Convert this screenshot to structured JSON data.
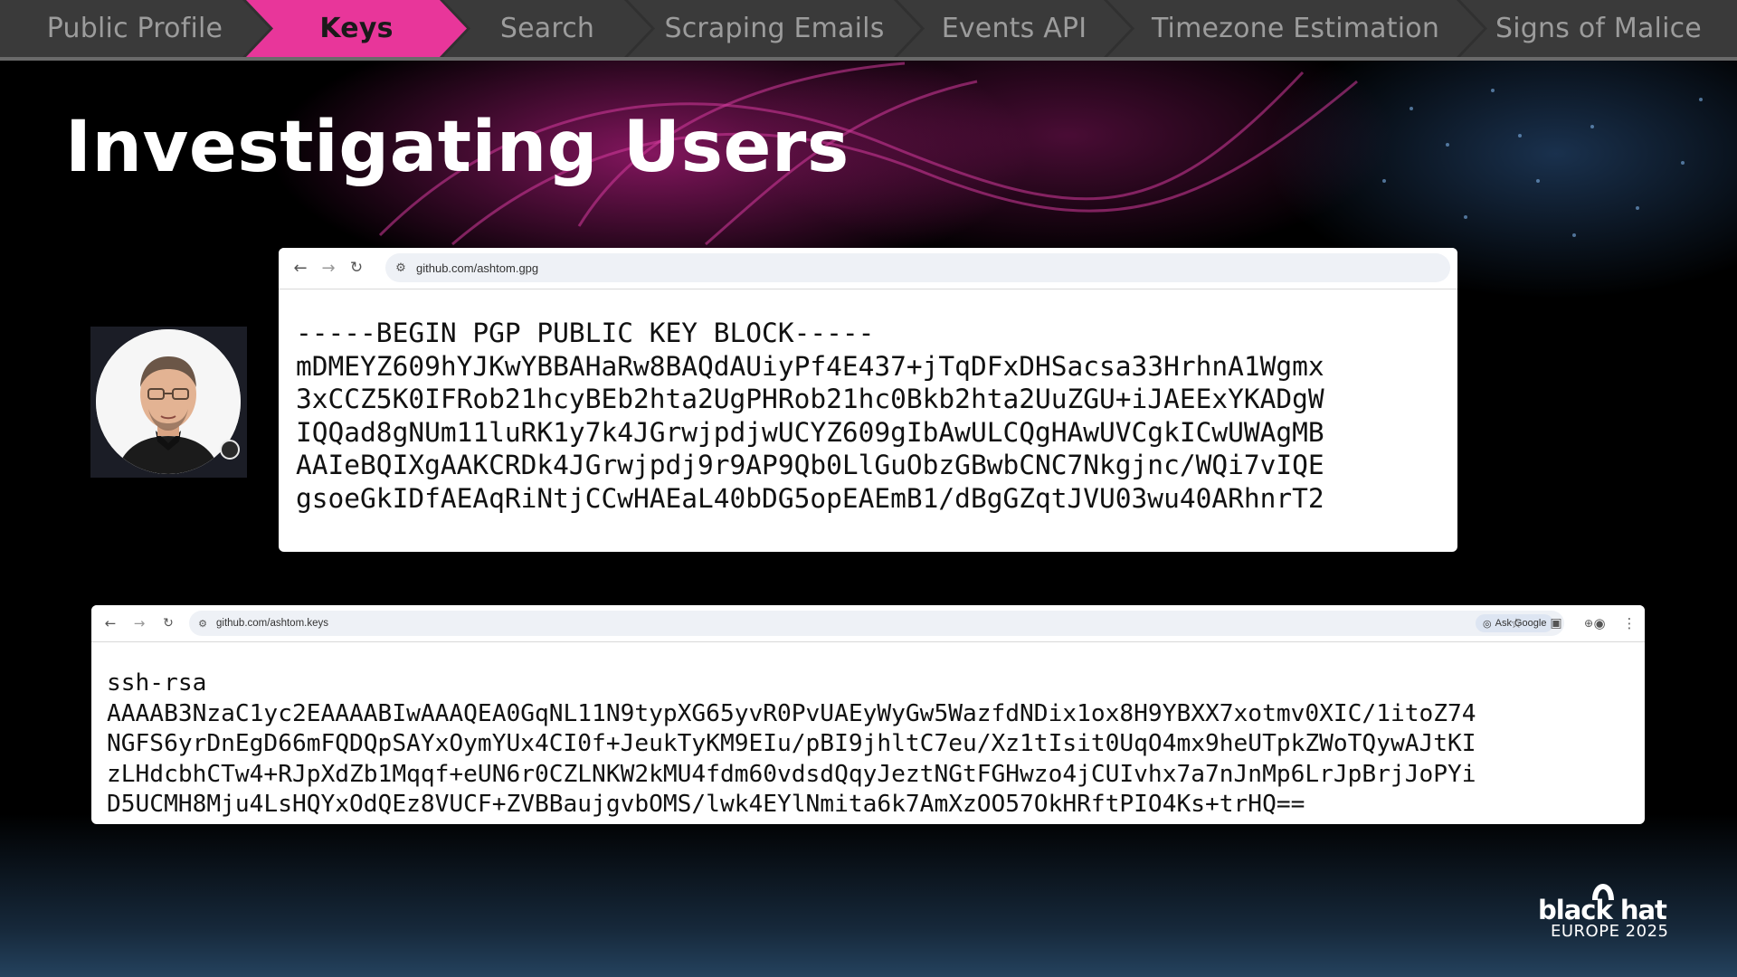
{
  "nav": {
    "items": [
      {
        "label": "Public Profile",
        "active": false
      },
      {
        "label": "Keys",
        "active": true
      },
      {
        "label": "Search",
        "active": false
      },
      {
        "label": "Scraping Emails",
        "active": false
      },
      {
        "label": "Events API",
        "active": false
      },
      {
        "label": "Timezone Estimation",
        "active": false
      },
      {
        "label": "Signs of Malice",
        "active": false
      }
    ]
  },
  "slide": {
    "title": "Investigating Users"
  },
  "gpg_window": {
    "url": "github.com/ashtom.gpg",
    "lines": [
      "-----BEGIN PGP PUBLIC KEY BLOCK-----",
      "",
      "mDMEYZ609hYJKwYBBAHaRw8BAQdAUiyPf4E437+jTqDFxDHSacsa33HrhnA1Wgmx",
      "3xCCZ5K0IFRob21hcyBEb2hta2UgPHRob21hc0Bkb2hta2UuZGU+iJAEExYKADgW",
      "IQQad8gNUm11luRK1y7k4JGrwjpdjwUCYZ609gIbAwULCQgHAwUVCgkICwUWAgMB",
      "AAIeBQIXgAAKCRDk4JGrwjpdj9r9AP9Qb0LlGuObzGBwbCNC7Nkgjnc/WQi7vIQE",
      "gsoeGkIDfAEAqRiNtjCCwHAEaL40bDG5opEAEmB1/dBgGZqtJVU03wu40ARhnrT2"
    ]
  },
  "keys_window": {
    "url": "github.com/ashtom.keys",
    "ask_google": "Ask Google",
    "lines": [
      "ssh-rsa",
      "AAAAB3NzaC1yc2EAAAABIwAAAQEA0GqNL11N9typXG65yvR0PvUAEyWyGw5WazfdNDix1ox8H9YBXX7xotmv0XIC/1itoZ74",
      "NGFS6yrDnEgD66mFQDQpSAYxOymYUx4CI0f+JeukTyKM9EIu/pBI9jhltC7eu/Xz1tIsit0UqO4mx9heUTpkZWoTQywAJtKI",
      "zLHdcbhCTw4+RJpXdZb1Mqqf+eUN6r0CZLNKW2kMU4fdm60vdsdQqyJeztNGtFGHwzo4jCUIvhx7a7nJnMp6LrJpBrjJoPYi",
      "D5UCMH8Mju4LsHQYxOdQEz8VUCF+ZVBBaujgvbOMS/lwk4EYlNmita6k7AmXzOO57OkHRftPIO4Ks+trHQ=="
    ]
  },
  "branding": {
    "logo_main": "black hat",
    "logo_sub": "EUROPE 2025"
  },
  "colors": {
    "accent": "#e8369a",
    "nav_bg": "#303030",
    "nav_text": "#9c9c9c"
  },
  "icons": [
    "back-arrow-icon",
    "forward-arrow-icon",
    "reload-icon",
    "site-info-icon",
    "zoom-icon",
    "star-icon",
    "extensions-icon",
    "profile-icon",
    "menu-icon"
  ]
}
